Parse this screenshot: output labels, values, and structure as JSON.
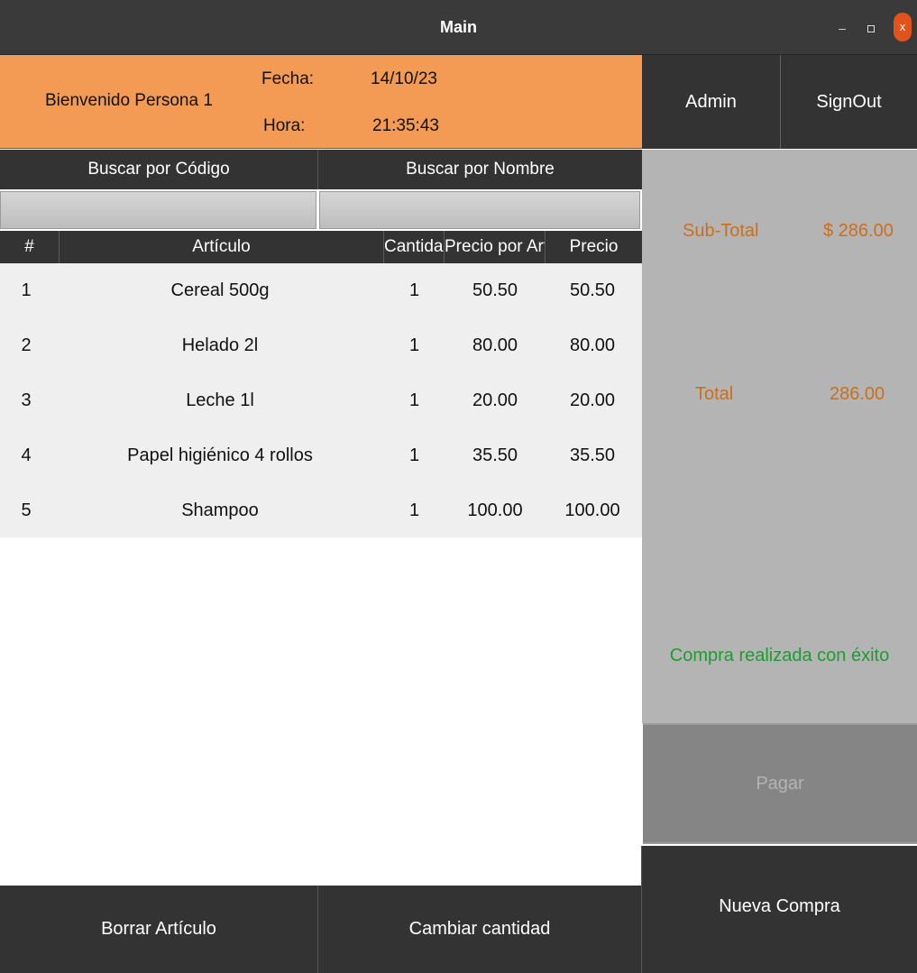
{
  "window": {
    "title": "Main",
    "minimize_glyph": "–",
    "close_glyph": "x",
    "close_color": "#e2531b"
  },
  "header": {
    "welcome": "Bienvenido Persona 1",
    "date_label": "Fecha:",
    "date_value": "14/10/23",
    "time_label": "Hora:",
    "time_value": "21:35:43",
    "accent_color": "#f39b55"
  },
  "top_buttons": {
    "admin": "Admin",
    "signout": "SignOut"
  },
  "search": {
    "by_code_label": "Buscar por Código",
    "by_name_label": "Buscar por Nombre",
    "code_value": "",
    "name_value": ""
  },
  "table": {
    "columns": [
      "#",
      "Artículo",
      "Cantidad",
      "Precio por Artícul",
      "Precio"
    ],
    "rows": [
      [
        "1",
        "Cereal 500g",
        "1",
        "50.50",
        "50.50"
      ],
      [
        "2",
        "Helado 2l",
        "1",
        "80.00",
        "80.00"
      ],
      [
        "3",
        "Leche 1l",
        "1",
        "20.00",
        "20.00"
      ],
      [
        "4",
        "Papel higiénico 4 rollos",
        "1",
        "35.50",
        "35.50"
      ],
      [
        "5",
        "Shampoo",
        "1",
        "100.00",
        "100.00"
      ]
    ]
  },
  "summary": {
    "subtotal_label": "Sub-Total",
    "subtotal_value": "$ 286.00",
    "total_label": "Total",
    "total_value": "286.00",
    "status_message": "Compra realizada con éxito",
    "label_color": "#c7701f",
    "success_color": "#1e9c2e"
  },
  "actions": {
    "pay": "Pagar",
    "new_purchase": "Nueva Compra",
    "delete_item": "Borrar Artículo",
    "change_quantity": "Cambiar cantidad"
  }
}
